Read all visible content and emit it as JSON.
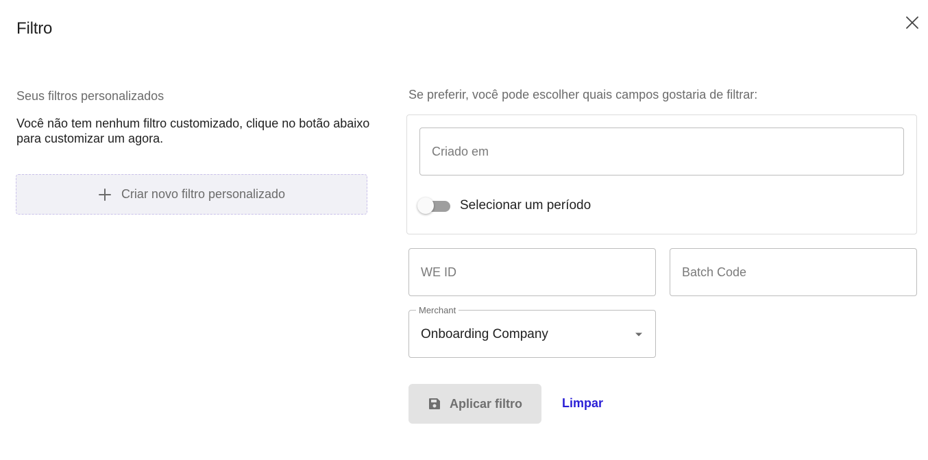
{
  "dialog": {
    "title": "Filtro",
    "close_icon": "close-icon"
  },
  "custom_filters": {
    "heading": "Seus filtros personalizados",
    "empty_message": "Você não tem nenhum filtro customizado, clique no botão abaixo para customizar um agora.",
    "create_button_label": "Criar novo filtro personalizado",
    "create_button_icon": "plus-icon"
  },
  "fields_section": {
    "heading": "Se preferir, você pode escolher quais campos gostaria de filtrar:",
    "created_at": {
      "placeholder": "Criado em",
      "value": ""
    },
    "period_toggle": {
      "label": "Selecionar um período",
      "checked": false
    },
    "we_id": {
      "placeholder": "WE ID",
      "value": ""
    },
    "batch_code": {
      "placeholder": "Batch Code",
      "value": ""
    },
    "merchant": {
      "label": "Merchant",
      "selected": "Onboarding Company"
    }
  },
  "actions": {
    "apply_label": "Aplicar filtro",
    "apply_icon": "save-icon",
    "clear_label": "Limpar"
  },
  "colors": {
    "link": "#2a1fd6",
    "apply_bg": "#e3e3e3",
    "dashed_border": "#c9c0ea"
  }
}
